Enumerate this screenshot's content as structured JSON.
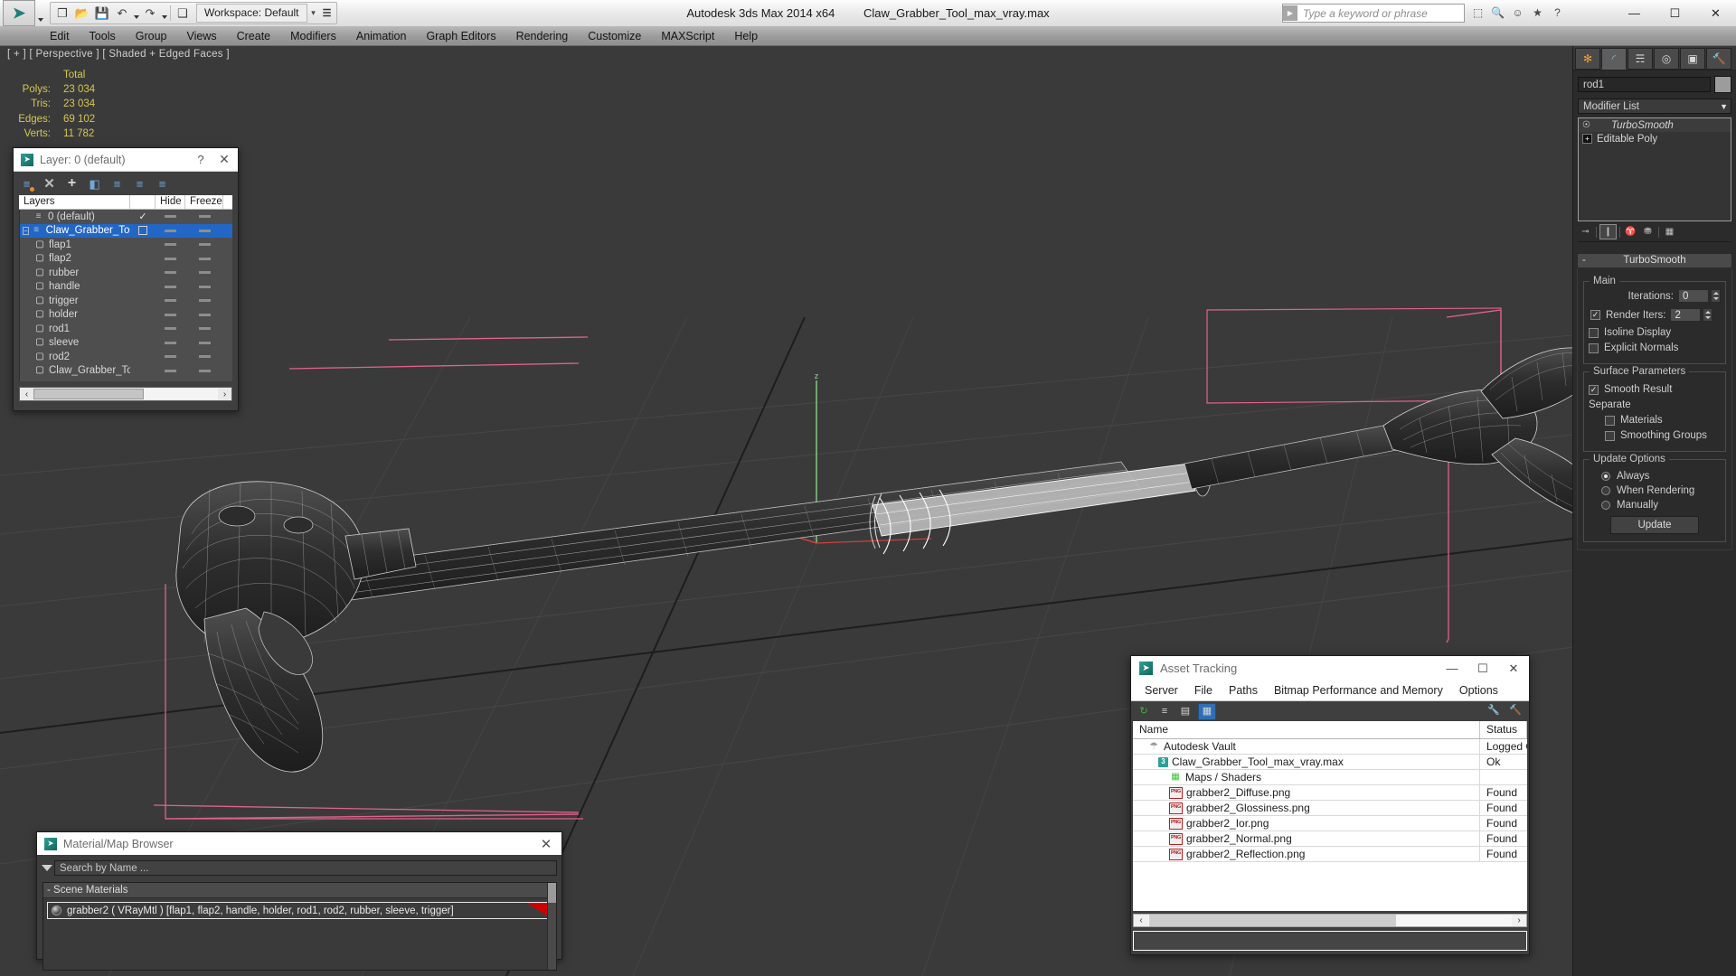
{
  "titlebar": {
    "logo_glyph": "➤",
    "quick_access": [
      {
        "name": "new-file-icon",
        "glyph": "❐"
      },
      {
        "name": "open-file-icon",
        "glyph": "📂"
      },
      {
        "name": "save-file-icon",
        "glyph": "💾"
      },
      {
        "name": "undo-icon",
        "glyph": "↶"
      },
      {
        "name": "redo-icon",
        "glyph": "↷"
      },
      {
        "name": "project-folder-icon",
        "glyph": "❑"
      }
    ],
    "workspace_label": "Workspace: Default",
    "app_name": "Autodesk 3ds Max  2014 x64",
    "file_name": "Claw_Grabber_Tool_max_vray.max",
    "search_placeholder": "Type a keyword or phrase",
    "help_icons": [
      {
        "name": "info-center-icon",
        "glyph": "⬚"
      },
      {
        "name": "search-icon",
        "glyph": "🔍"
      },
      {
        "name": "signin-icon",
        "glyph": "☺"
      },
      {
        "name": "favorites-star-icon",
        "glyph": "★"
      },
      {
        "name": "help-icon",
        "glyph": "?"
      }
    ],
    "window_buttons": [
      {
        "name": "minimize-button",
        "glyph": "—"
      },
      {
        "name": "maximize-button",
        "glyph": "☐"
      },
      {
        "name": "close-button",
        "glyph": "✕"
      }
    ]
  },
  "menubar": {
    "items": [
      "Edit",
      "Tools",
      "Group",
      "Views",
      "Create",
      "Modifiers",
      "Animation",
      "Graph Editors",
      "Rendering",
      "Customize",
      "MAXScript",
      "Help"
    ]
  },
  "viewport": {
    "label": "[ + ] [ Perspective ] [ Shaded + Edged Faces ]",
    "stats_header": "Total",
    "stats": [
      {
        "label": "Polys:",
        "value": "23 034"
      },
      {
        "label": "Tris:",
        "value": "23 034"
      },
      {
        "label": "Edges:",
        "value": "69 102"
      },
      {
        "label": "Verts:",
        "value": "11 782"
      }
    ],
    "stats_color": "#d6c752"
  },
  "command_panel": {
    "tabs": [
      {
        "name": "create-tab",
        "glyph": "✻",
        "cls": "orange",
        "active": false
      },
      {
        "name": "modify-tab",
        "glyph": "◜",
        "cls": "blue",
        "active": true
      },
      {
        "name": "hierarchy-tab",
        "glyph": "☴",
        "cls": "",
        "active": false
      },
      {
        "name": "motion-tab",
        "glyph": "◎",
        "cls": "",
        "active": false
      },
      {
        "name": "display-tab",
        "glyph": "▣",
        "cls": "",
        "active": false
      },
      {
        "name": "utilities-tab",
        "glyph": "🔨",
        "cls": "hammer",
        "active": false
      }
    ],
    "object_name": "rod1",
    "modifier_list_label": "Modifier List",
    "modifier_stack": [
      {
        "name": "TurboSmooth",
        "type": "modifier",
        "icon": "lightbulb-icon"
      },
      {
        "name": "Editable Poly",
        "type": "base",
        "icon": "plus-box-icon"
      }
    ],
    "stack_tools": [
      {
        "name": "pin-stack-icon",
        "glyph": "⊸",
        "boxed": false
      },
      {
        "name": "show-end-result-icon",
        "glyph": "❙",
        "boxed": true
      },
      {
        "name": "make-unique-icon",
        "glyph": "♈",
        "boxed": false
      },
      {
        "name": "remove-modifier-icon",
        "glyph": "⛃",
        "boxed": false
      },
      {
        "name": "configure-sets-icon",
        "glyph": "▦",
        "boxed": false
      }
    ],
    "rollout": {
      "title": "TurboSmooth",
      "collapse_glyph": "-",
      "groups": [
        {
          "caption": "Main",
          "fields": [
            {
              "name": "iterations",
              "label": "Iterations:",
              "value": "0"
            },
            {
              "name": "render-iters",
              "label": "Render Iters:",
              "value": "2",
              "checkbox": true,
              "checked": true
            }
          ],
          "checkboxes": [
            {
              "name": "isoline-display",
              "label": "Isoline Display",
              "checked": false
            },
            {
              "name": "explicit-normals",
              "label": "Explicit Normals",
              "checked": false
            }
          ]
        },
        {
          "caption": "Surface Parameters",
          "checkboxes": [
            {
              "name": "smooth-result",
              "label": "Smooth Result",
              "checked": true
            }
          ],
          "sub_label": "Separate",
          "sub_checkboxes": [
            {
              "name": "separate-materials",
              "label": "Materials",
              "checked": false
            },
            {
              "name": "separate-smoothing-groups",
              "label": "Smoothing Groups",
              "checked": false
            }
          ]
        },
        {
          "caption": "Update Options",
          "radios": [
            {
              "name": "update-always",
              "label": "Always",
              "checked": true
            },
            {
              "name": "update-when-rendering",
              "label": "When Rendering",
              "checked": false
            },
            {
              "name": "update-manually",
              "label": "Manually",
              "checked": false
            }
          ],
          "button": "Update"
        }
      ]
    }
  },
  "layer_dialog": {
    "title": "Layer: 0 (default)",
    "help_glyph": "?",
    "close_glyph": "✕",
    "toolbar": [
      {
        "name": "create-new-layer-icon",
        "glyph": "≡",
        "dot": true
      },
      {
        "name": "delete-layer-icon",
        "glyph": "✕",
        "style": "xx"
      },
      {
        "name": "add-selection-icon",
        "glyph": "+",
        "style": "pp"
      },
      {
        "name": "select-objects-in-layer-icon",
        "glyph": "◧"
      },
      {
        "name": "select-highlighted-layers-icon",
        "glyph": "≡"
      },
      {
        "name": "highlight-selected-objects-icon",
        "glyph": "≡"
      },
      {
        "name": "hide-unhide-icon",
        "glyph": "≡"
      }
    ],
    "columns": [
      "Layers",
      "",
      "Hide",
      "Freeze",
      ""
    ],
    "rows": [
      {
        "name": "0 (default)",
        "indent": 0,
        "icon": "layer-icon",
        "expander": "none",
        "selected": false,
        "check": "check",
        "hide": "dash",
        "freeze": "dash"
      },
      {
        "name": "Claw_Grabber_Tool",
        "indent": 0,
        "icon": "layer-icon",
        "expander": "minus",
        "selected": true,
        "check": "empty-box",
        "hide": "dash",
        "freeze": "dash"
      },
      {
        "name": "flap1",
        "indent": 1,
        "icon": "object-icon",
        "expander": "none",
        "selected": false,
        "check": "",
        "hide": "dash",
        "freeze": "dash"
      },
      {
        "name": "flap2",
        "indent": 1,
        "icon": "object-icon",
        "expander": "none",
        "selected": false,
        "check": "",
        "hide": "dash",
        "freeze": "dash"
      },
      {
        "name": "rubber",
        "indent": 1,
        "icon": "object-icon",
        "expander": "none",
        "selected": false,
        "check": "",
        "hide": "dash",
        "freeze": "dash"
      },
      {
        "name": "handle",
        "indent": 1,
        "icon": "object-icon",
        "expander": "none",
        "selected": false,
        "check": "",
        "hide": "dash",
        "freeze": "dash"
      },
      {
        "name": "trigger",
        "indent": 1,
        "icon": "object-icon",
        "expander": "none",
        "selected": false,
        "check": "",
        "hide": "dash",
        "freeze": "dash"
      },
      {
        "name": "holder",
        "indent": 1,
        "icon": "object-icon",
        "expander": "none",
        "selected": false,
        "check": "",
        "hide": "dash",
        "freeze": "dash"
      },
      {
        "name": "rod1",
        "indent": 1,
        "icon": "object-icon",
        "expander": "none",
        "selected": false,
        "check": "",
        "hide": "dash",
        "freeze": "dash"
      },
      {
        "name": "sleeve",
        "indent": 1,
        "icon": "object-icon",
        "expander": "none",
        "selected": false,
        "check": "",
        "hide": "dash",
        "freeze": "dash"
      },
      {
        "name": "rod2",
        "indent": 1,
        "icon": "object-icon",
        "expander": "none",
        "selected": false,
        "check": "",
        "hide": "dash",
        "freeze": "dash"
      },
      {
        "name": "Claw_Grabber_Tool",
        "indent": 1,
        "icon": "object-icon",
        "expander": "none",
        "selected": false,
        "check": "",
        "hide": "dash",
        "freeze": "dash"
      }
    ],
    "scroll_left_glyph": "‹",
    "scroll_right_glyph": "›"
  },
  "material_browser": {
    "title": "Material/Map Browser",
    "close_glyph": "✕",
    "search_placeholder": "Search by Name ...",
    "group_label": "- Scene Materials",
    "material": "grabber2  ( VRayMtl )  [flap1, flap2, handle, holder, rod1, rod2, rubber, sleeve, trigger]"
  },
  "asset_tracking": {
    "title": "Asset Tracking",
    "window_buttons": [
      {
        "name": "minimize-button",
        "glyph": "—"
      },
      {
        "name": "maximize-button",
        "glyph": "☐"
      },
      {
        "name": "close-button",
        "glyph": "✕"
      }
    ],
    "menu": [
      "Server",
      "File",
      "Paths",
      "Bitmap Performance and Memory",
      "Options"
    ],
    "toolbar": [
      {
        "name": "refresh-icon",
        "glyph": "↻",
        "green": true,
        "boxed": false
      },
      {
        "name": "list-view-icon",
        "glyph": "≡",
        "green": false,
        "boxed": false
      },
      {
        "name": "detail-view-icon",
        "glyph": "▤",
        "green": false,
        "boxed": false
      },
      {
        "name": "grid-view-icon",
        "glyph": "▦",
        "green": false,
        "boxed": true
      }
    ],
    "toolbar_right": [
      {
        "name": "add-asset-icon",
        "glyph": "🔧"
      },
      {
        "name": "asset-options-icon",
        "glyph": "🔨"
      }
    ],
    "columns": [
      "Name",
      "Status"
    ],
    "rows": [
      {
        "name": "Autodesk Vault",
        "status": "Logged Ou",
        "indent": 0,
        "icon": "vault-icon"
      },
      {
        "name": "Claw_Grabber_Tool_max_vray.max",
        "status": "Ok",
        "indent": 1,
        "icon": "max-file-icon"
      },
      {
        "name": "Maps / Shaders",
        "status": "",
        "indent": 2,
        "icon": "maps-icon"
      },
      {
        "name": "grabber2_Diffuse.png",
        "status": "Found",
        "indent": 2,
        "icon": "png-icon"
      },
      {
        "name": "grabber2_Glossiness.png",
        "status": "Found",
        "indent": 2,
        "icon": "png-icon"
      },
      {
        "name": "grabber2_Ior.png",
        "status": "Found",
        "indent": 2,
        "icon": "png-icon"
      },
      {
        "name": "grabber2_Normal.png",
        "status": "Found",
        "indent": 2,
        "icon": "png-icon"
      },
      {
        "name": "grabber2_Reflection.png",
        "status": "Found",
        "indent": 2,
        "icon": "png-icon"
      }
    ],
    "scroll_left_glyph": "‹",
    "scroll_right_glyph": "›"
  },
  "colors": {
    "accent_blue": "#2267c6",
    "viewport_bg": "#3a3a3a",
    "stats_yellow": "#d6c752",
    "wireframe": "#d8d8d8",
    "helper_pink": "#e0628c"
  }
}
